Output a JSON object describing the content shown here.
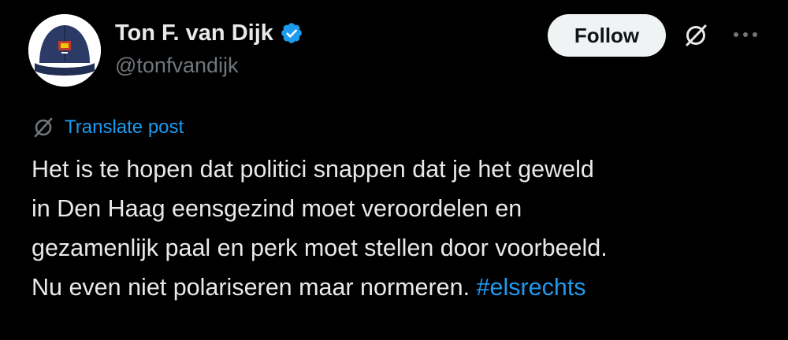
{
  "author": {
    "display_name": "Ton F. van Dijk",
    "handle": "@tonfvandijk",
    "verified": true
  },
  "actions": {
    "follow_label": "Follow",
    "grok_icon": "grok-slash-circle-icon",
    "more_icon": "more-dots-icon"
  },
  "translate": {
    "label": "Translate post",
    "icon": "grok-slash-circle-icon"
  },
  "post": {
    "lines": [
      "Het is te hopen dat politici snappen dat je het geweld",
      "in Den Haag eensgezind moet veroordelen en",
      "gezamenlijk paal en perk moet stellen door voorbeeld.",
      "Nu even niet polariseren maar normeren."
    ],
    "hashtag": "#elsrechts"
  },
  "colors": {
    "background": "#000000",
    "text_primary": "#e7e9ea",
    "text_secondary": "#71767b",
    "link": "#1d9bf0",
    "verified": "#1d9bf0",
    "follow_bg": "#eff3f4",
    "follow_text": "#0f1419"
  }
}
